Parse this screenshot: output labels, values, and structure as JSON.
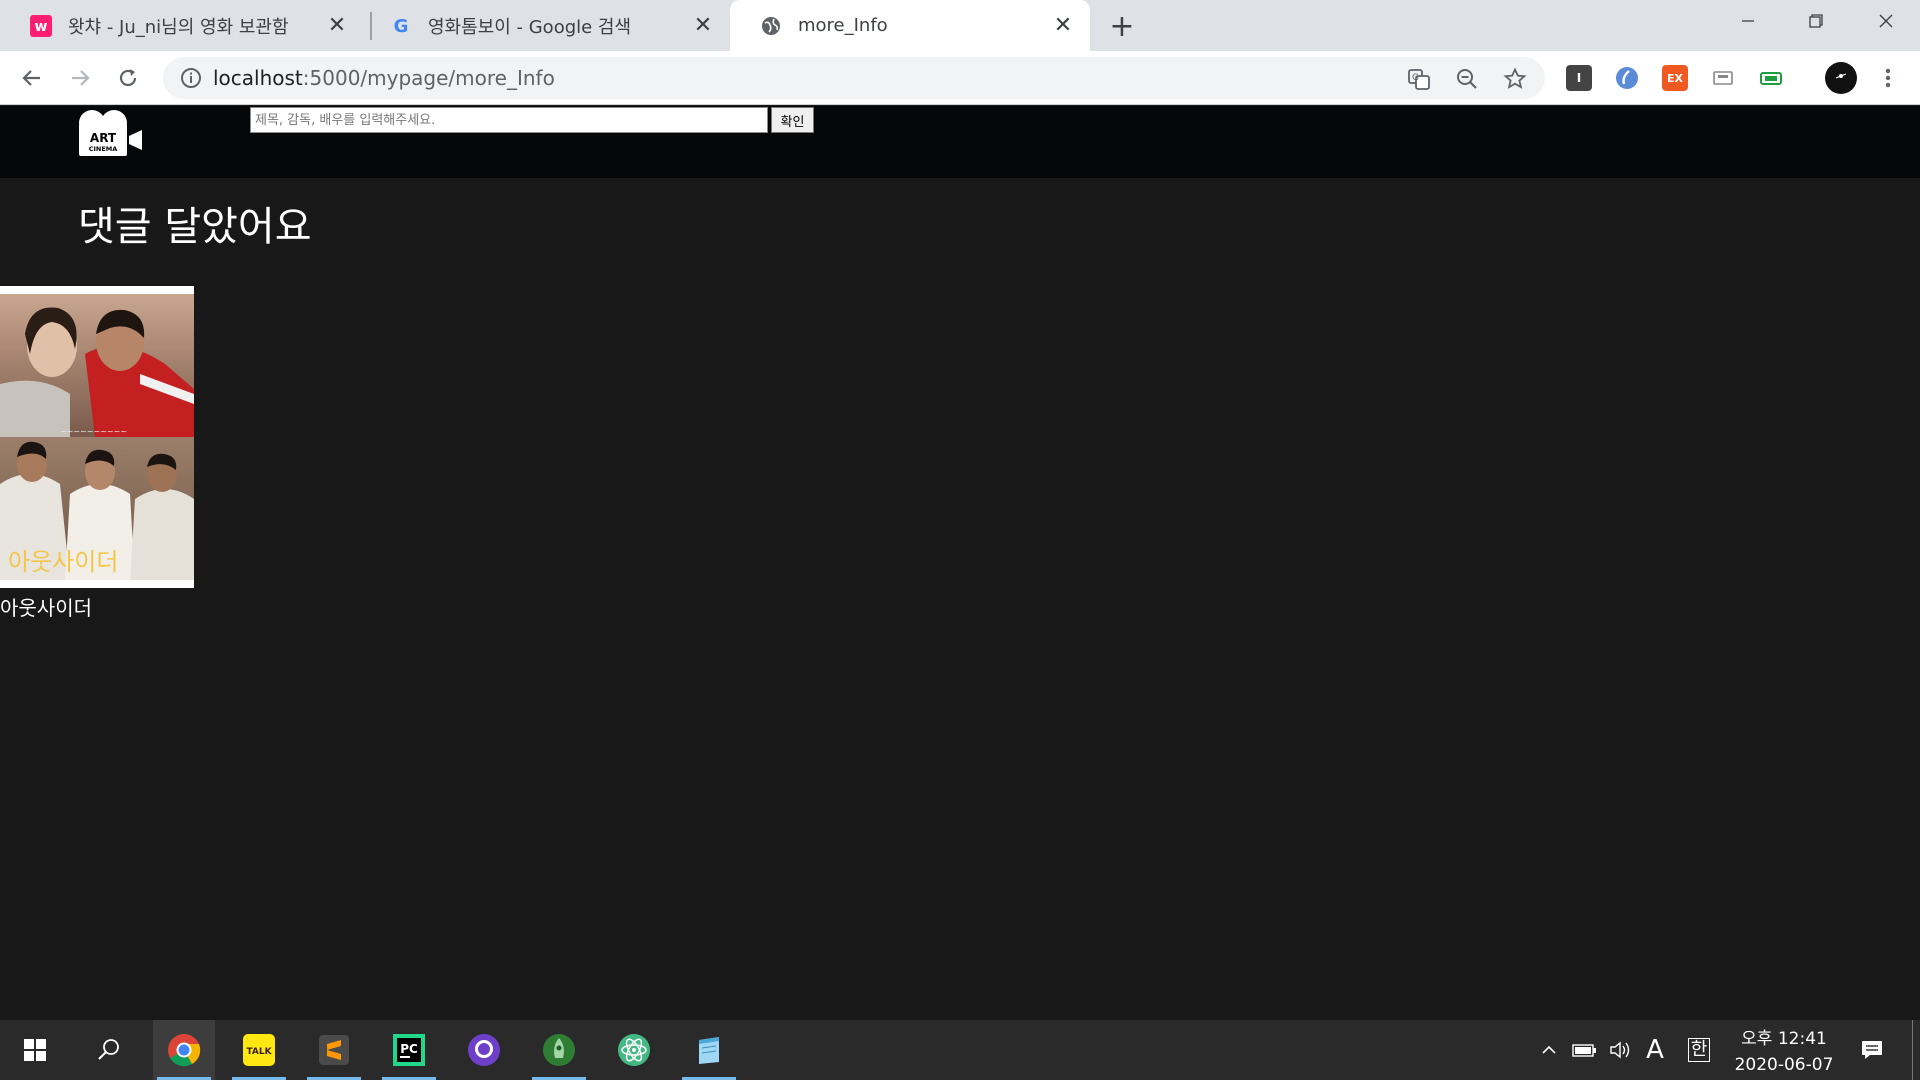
{
  "browser": {
    "tabs": [
      {
        "title": "왓챠 - Ju_ni님의 영화 보관함",
        "favicon": "watcha-icon",
        "active": false
      },
      {
        "title": "영화톰보이 - Google 검색",
        "favicon": "google-icon",
        "active": false
      },
      {
        "title": "more_Info",
        "favicon": "globe-icon",
        "active": true
      }
    ],
    "url_host": "localhost",
    "url_path": ":5000/mypage/more_Info"
  },
  "site": {
    "search": {
      "placeholder": "제목, 감독, 배우를 입력해주세요.",
      "value": ""
    },
    "search_button_label": "확인",
    "page_title": "댓글 달았어요",
    "movies": [
      {
        "title": "아웃사이더"
      }
    ]
  },
  "taskbar": {
    "tray": {
      "ime_a": "A",
      "ime_han": "한"
    },
    "clock": {
      "time": "오후 12:41",
      "date": "2020-06-07"
    }
  },
  "colors": {
    "page_bg": "#181818",
    "header_bg": "#050708",
    "tab_strip": "#dee1e6",
    "taskbar": "#2a2a2a",
    "accent": "#76b9ed"
  }
}
